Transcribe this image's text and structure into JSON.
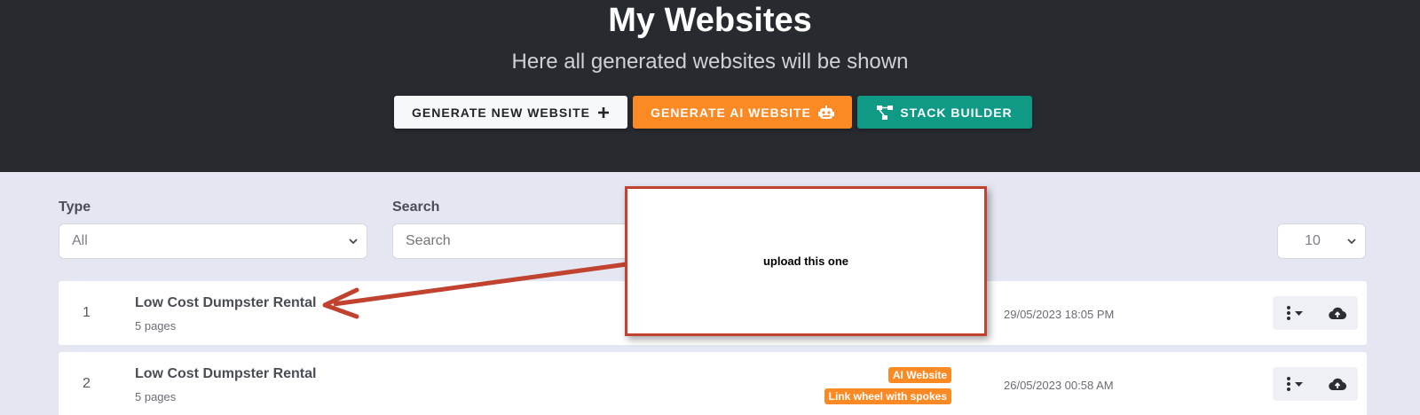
{
  "header": {
    "title": "My Websites",
    "subtitle": "Here all generated websites will be shown"
  },
  "actions": {
    "generate_new_label": "GENERATE NEW WEBSITE",
    "generate_ai_label": "GENERATE AI WEBSITE",
    "stack_builder_label": "STACK BUILDER"
  },
  "filters": {
    "type_label": "Type",
    "type_value": "All",
    "search_label": "Search",
    "search_placeholder": "Search",
    "per_page_value": "10"
  },
  "rows": [
    {
      "index": "1",
      "title": "Low Cost Dumpster Rental",
      "pages": "5 pages",
      "date": "29/05/2023 18:05 PM",
      "tags": []
    },
    {
      "index": "2",
      "title": "Low Cost Dumpster Rental",
      "pages": "5 pages",
      "date": "26/05/2023 00:58 AM",
      "tags": [
        "AI Website",
        "Link wheel with spokes"
      ]
    }
  ],
  "annotation": {
    "text": "upload this one"
  },
  "colors": {
    "hero_bg": "#272a2f",
    "page_bg": "#e4e6f1",
    "orange": "#fb8a24",
    "teal": "#0f9a86",
    "annotation_red": "#c0422f"
  },
  "icons": [
    "plus-icon",
    "robot-icon",
    "stack-icon",
    "chevron-down-icon",
    "kebab-menu-icon",
    "cloud-upload-icon"
  ]
}
